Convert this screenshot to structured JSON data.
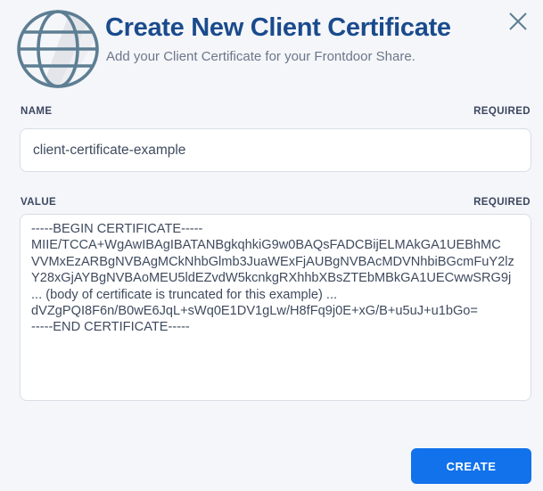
{
  "header": {
    "title": "Create New Client Certificate",
    "subtitle": "Add your Client Certificate for your Frontdoor Share."
  },
  "icons": {
    "globe": "globe-icon",
    "close": "close-icon"
  },
  "fields": {
    "name": {
      "label": "NAME",
      "required_label": "REQUIRED",
      "value": "client-certificate-example"
    },
    "value": {
      "label": "VALUE",
      "required_label": "REQUIRED",
      "value": "-----BEGIN CERTIFICATE-----\nMIIE/TCCA+WgAwIBAgIBATANBgkqhkiG9w0BAQsFADCBijELMAkGA1UEBhMC\nVVMxEzARBgNVBAgMCkNhbGlmb3JuaWExFjAUBgNVBAcMDVNhbiBGcmFuY2lz\nY28xGjAYBgNVBAoMEU5ldEZvdW5kcnkgRXhhbXBsZTEbMBkGA1UECwwSRG9j\n... (body of certificate is truncated for this example) ...\ndVZgPQI8F6n/B0wE6JqL+sWq0E1DV1gLw/H8fFq9j0E+xG/B+u5uJ+u1bGo=\n-----END CERTIFICATE-----"
    }
  },
  "footer": {
    "create_label": "CREATE"
  },
  "colors": {
    "title-color": "#1a4b8c",
    "accent": "#1172eb",
    "bg": "#f5f6fa",
    "label-color": "#3b4760",
    "text-color": "#3f4b5e",
    "muted": "#6b7789",
    "border": "#d9dde6",
    "icon-stroke": "#5d7e93"
  }
}
